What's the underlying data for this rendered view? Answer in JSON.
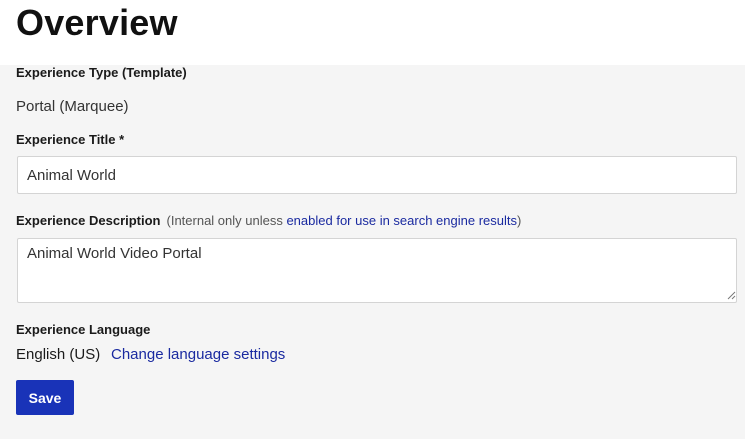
{
  "page": {
    "title": "Overview"
  },
  "experience_type": {
    "label": "Experience Type (Template)",
    "value": "Portal (Marquee)"
  },
  "experience_title": {
    "label": "Experience Title *",
    "value": "Animal World"
  },
  "experience_description": {
    "label": "Experience Description",
    "hint_prefix": "(Internal only unless ",
    "hint_link": "enabled for use in search engine results",
    "hint_suffix": ")",
    "value": "Animal World Video Portal"
  },
  "experience_language": {
    "label": "Experience Language",
    "value": "English (US)",
    "change_link": "Change language settings"
  },
  "actions": {
    "save_label": "Save"
  },
  "colors": {
    "accent": "#1933b8",
    "link": "#1a2aa0",
    "background": "#f5f5f5"
  }
}
